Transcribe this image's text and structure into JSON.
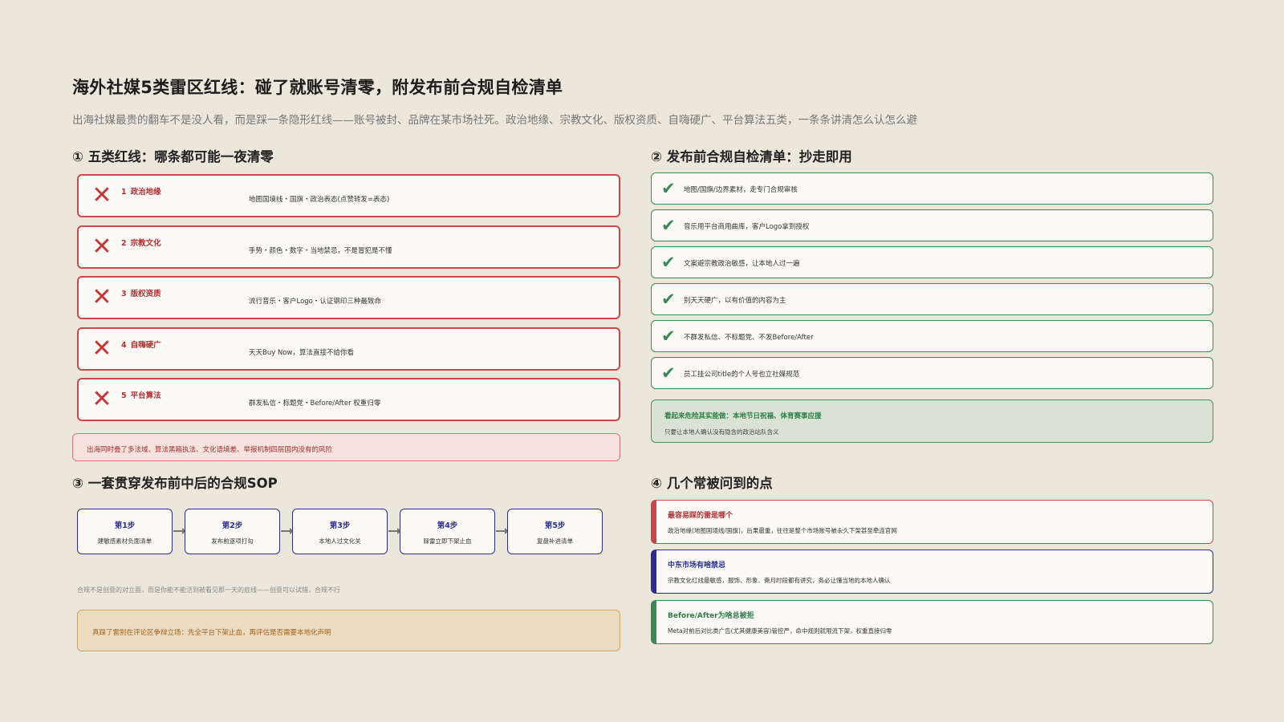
{
  "header": {
    "title": "海外社媒5类雷区红线：碰了就账号清零，附发布前合规自检清单",
    "subtitle": "出海社媒最贵的翻车不是没人看，而是踩一条隐形红线——账号被封、品牌在某市场社死。政治地缘、宗教文化、版权资质、自嗨硬广、平台算法五类，一条条讲清怎么认怎么避"
  },
  "section1": {
    "title": "① 五类红线：哪条都可能一夜清零",
    "items": [
      {
        "num": "1",
        "name": "政治地缘",
        "desc": "地图国境线・国旗・政治表态(点赞转发=表态)",
        "icon": "cross-icon"
      },
      {
        "num": "2",
        "name": "宗教文化",
        "desc": "手势・颜色・数字・当地禁忌，不是冒犯是不懂",
        "icon": "cross-icon"
      },
      {
        "num": "3",
        "name": "版权资质",
        "desc": "流行音乐・客户Logo・认证钢印三种最致命",
        "icon": "cross-icon"
      },
      {
        "num": "4",
        "name": "自嗨硬广",
        "desc": "天天Buy Now，算法直接不给你看",
        "icon": "cross-icon"
      },
      {
        "num": "5",
        "name": "平台算法",
        "desc": "群发私信・标题党・Before/After 权重归零",
        "icon": "cross-icon"
      }
    ],
    "warning": "出海同时叠了多法域、算法黑箱执法、文化语境差、举报机制四层国内没有的风险"
  },
  "section2": {
    "title": "② 发布前合规自检清单：抄走即用",
    "items": [
      "地图/国旗/边界素材，走专门合规审核",
      "音乐用平台商用曲库，客户Logo拿到授权",
      "文案避宗教政治敏感，让本地人过一遍",
      "别天天硬广，以有价值的内容为主",
      "不群发私信、不标题党、不发Before/After",
      "员工挂公司title的个人号也立社媒规范"
    ],
    "note": {
      "heading": "看起来危险其实能做：本地节日祝福、体育赛事应援",
      "body": "只要让本地人确认没有隐含的政治站队含义"
    }
  },
  "section3": {
    "title": "③ 一套贯穿发布前中后的合规SOP",
    "steps": [
      {
        "label": "第1步",
        "desc": "建敏感素材负面清单"
      },
      {
        "label": "第2步",
        "desc": "发布前逐项打勾"
      },
      {
        "label": "第3步",
        "desc": "本地人过文化关"
      },
      {
        "label": "第4步",
        "desc": "踩雷立即下架止血"
      },
      {
        "label": "第5步",
        "desc": "复盘补进清单"
      }
    ],
    "note": "合规不是创意的对立面，而是你能不能活到被看见那一天的底线——创意可以试错，合规不行",
    "tip": "真踩了雷别在评论区争辩立场：先全平台下架止血，再评估是否需要本地化声明"
  },
  "section4": {
    "title": "④ 几个常被问到的点",
    "faqs": [
      {
        "q": "最容易踩的雷是哪个",
        "a": "政治地缘(地图国境线/国旗)，后果最重，往往是整个市场账号被永久下架甚至牵连官网"
      },
      {
        "q": "中东市场有啥禁忌",
        "a": "宗教文化红线最敏感，服饰、形象、斋月时段都有讲究，务必让懂当地的本地人确认"
      },
      {
        "q": "Before/After为啥总被拒",
        "a": "Meta对前后对比类广告(尤其健康美容)管控严，命中规则就限流下架，权重直接归零"
      }
    ]
  },
  "colors": {
    "background": "#ebe7da",
    "red": "#c9474a",
    "green": "#3b8a55",
    "navy": "#2c2f8f",
    "tan": "#c9a36a"
  }
}
